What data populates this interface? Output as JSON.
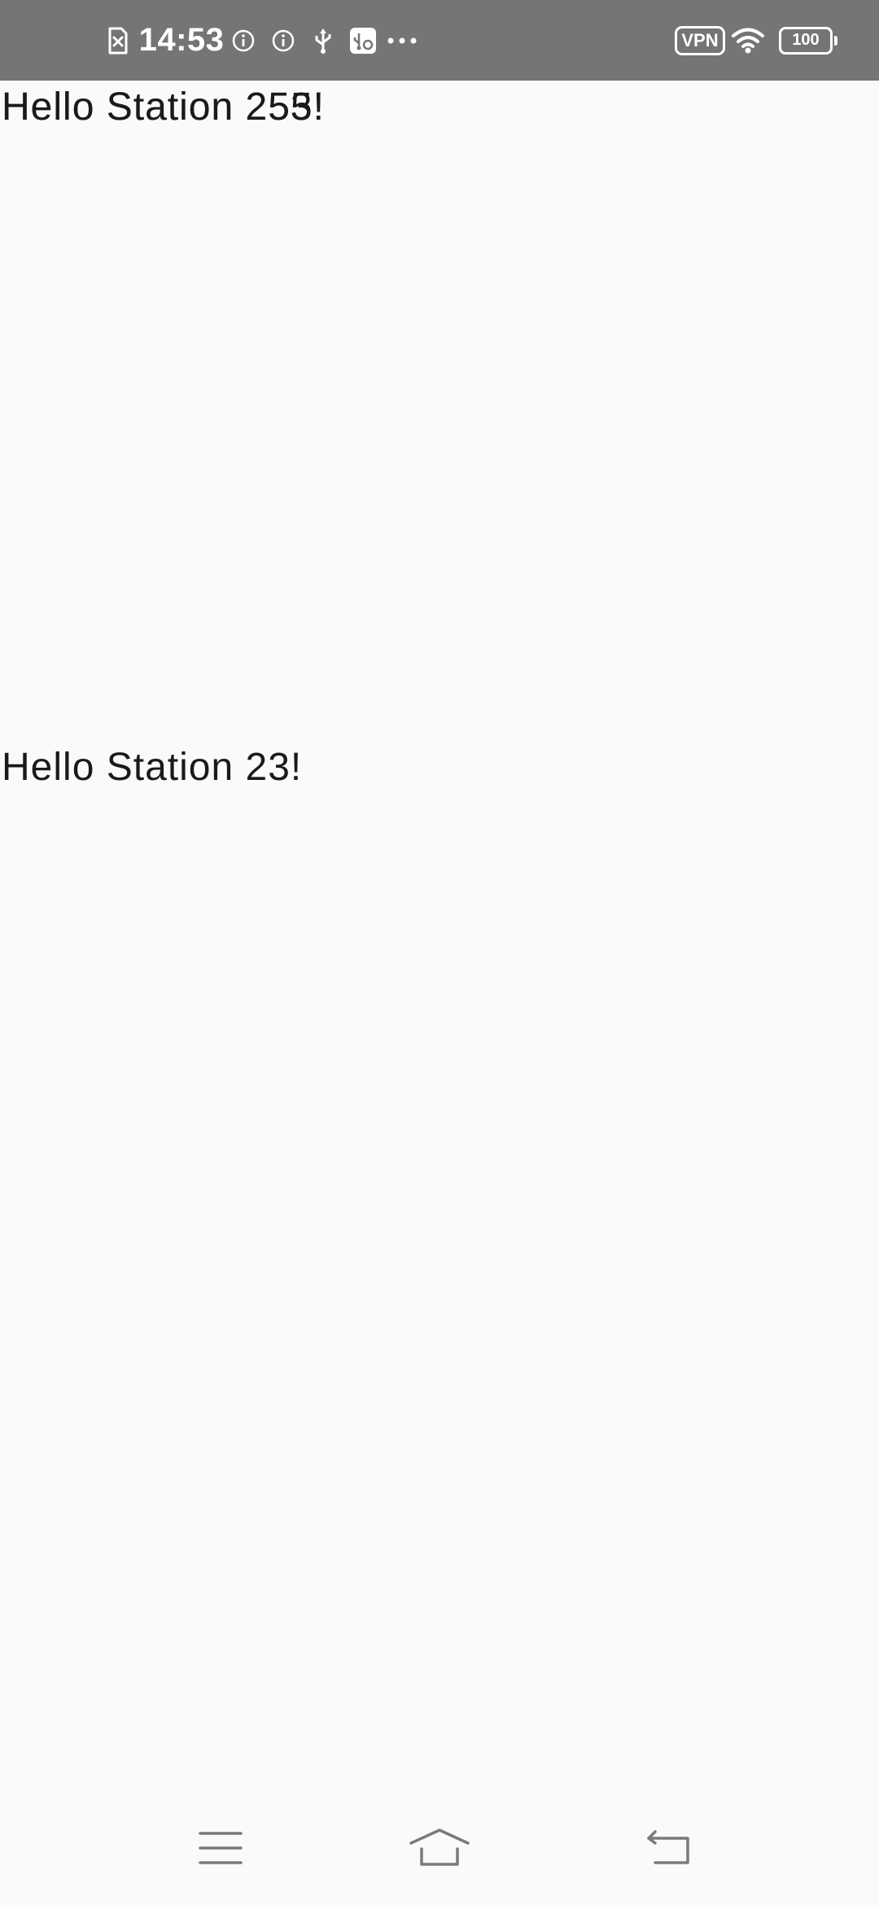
{
  "status_bar": {
    "time": "14:53",
    "vpn_label": "VPN",
    "battery_level": "100",
    "icons": [
      "sim-error-icon",
      "info-icon",
      "info-icon",
      "usb-icon",
      "usb-settings-icon",
      "more-dots-icon",
      "vpn-icon",
      "wifi-icon",
      "battery-icon"
    ]
  },
  "content": {
    "hello_top_a": "Hello Station 255!",
    "hello_top_b": "Hello Station 253!",
    "hello_bottom": "Hello Station 23!"
  },
  "nav_bar": {
    "icons": [
      "menu-icon",
      "home-icon",
      "back-icon"
    ]
  },
  "colors": {
    "status_bar_bg": "#757575",
    "background": "#fafafa",
    "text": "#1a1a1a",
    "nav_icon": "#7a7a7a"
  }
}
